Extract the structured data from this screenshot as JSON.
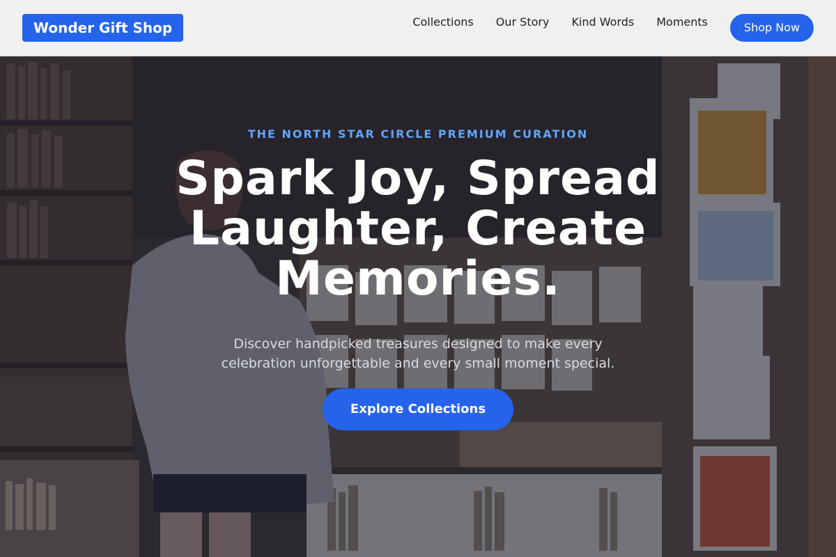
{
  "header": {
    "brand": "Wonder Gift Shop",
    "nav": [
      {
        "label": "Collections"
      },
      {
        "label": "Our Story"
      },
      {
        "label": "Kind Words"
      },
      {
        "label": "Moments"
      }
    ],
    "cta_label": "Shop Now"
  },
  "hero": {
    "eyebrow": "THE NORTH STAR CIRCLE PREMIUM CURATION",
    "headline": "Spark Joy, Spread Laughter, Create Memories.",
    "subtext": "Discover handpicked treasures designed to make every celebration unforgettable and every small moment special.",
    "cta_label": "Explore Collections",
    "background_image": "gift-shop-photo"
  },
  "colors": {
    "accent": "#2563eb",
    "eyebrow": "#60a5fa",
    "header_bg": "#f0f0f0",
    "nav_text": "#222222"
  }
}
